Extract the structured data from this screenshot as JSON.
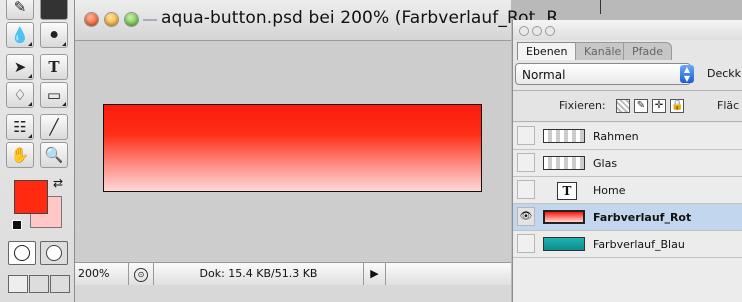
{
  "document": {
    "title": "aqua-button.psd bei 200% (Farbverlauf_Rot, R...",
    "zoom": "200%",
    "doc_info": "Dok: 15.4 KB/51.3 KB"
  },
  "toolbox": {
    "foreground_color": "#ff2a10",
    "background_color": "#ffc8c6"
  },
  "layers_panel": {
    "tabs": [
      "Ebenen",
      "Kanäle",
      "Pfade"
    ],
    "blend_mode": "Normal",
    "opacity_label": "Deckk",
    "lock_label": "Fixieren:",
    "fill_label": "Fläc",
    "layers": [
      {
        "name": "Rahmen",
        "visible": false,
        "selected": false,
        "type": "pixel",
        "thumb": "transparent"
      },
      {
        "name": "Glas",
        "visible": false,
        "selected": false,
        "type": "pixel",
        "thumb": "transparent"
      },
      {
        "name": "Home",
        "visible": false,
        "selected": false,
        "type": "text",
        "thumb": "T"
      },
      {
        "name": "Farbverlauf_Rot",
        "visible": true,
        "selected": true,
        "type": "pixel",
        "thumb": "red-gradient"
      },
      {
        "name": "Farbverlauf_Blau",
        "visible": false,
        "selected": false,
        "type": "pixel",
        "thumb": "teal-gradient"
      }
    ]
  }
}
